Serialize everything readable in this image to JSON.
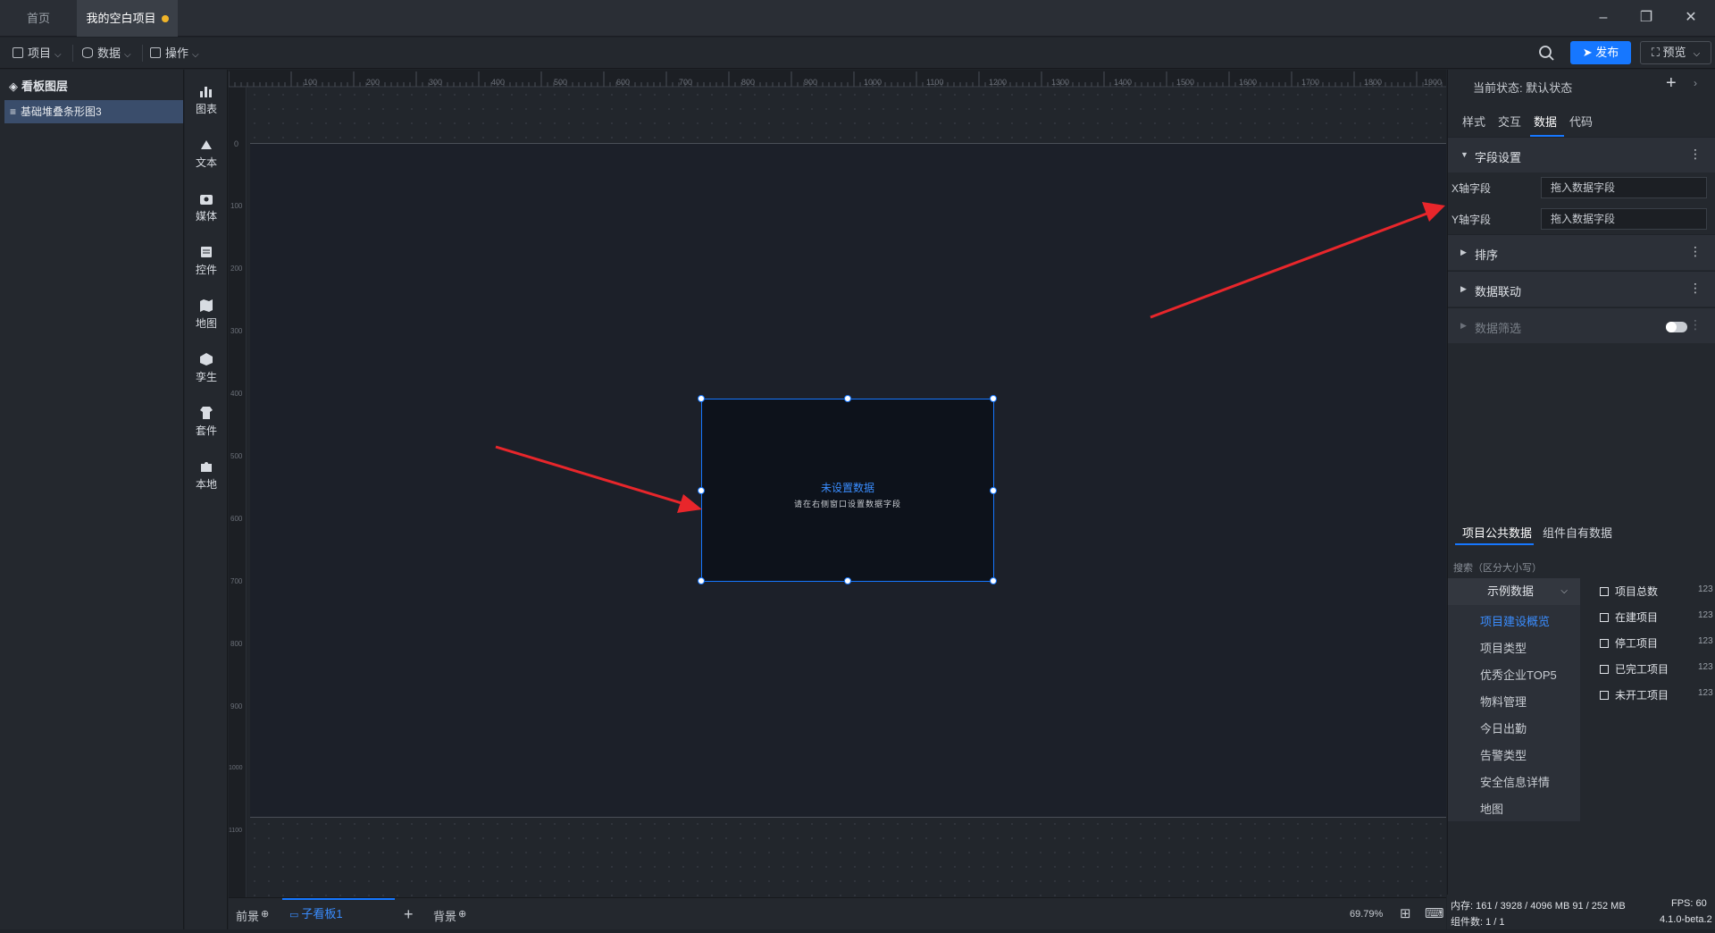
{
  "titlebar": {
    "tabs": [
      {
        "label": "首页"
      },
      {
        "label": "我的空白项目"
      }
    ]
  },
  "toolbar": {
    "menus": [
      {
        "label": "项目"
      },
      {
        "label": "数据"
      },
      {
        "label": "操作"
      }
    ],
    "publish_label": "发布",
    "preview_label": "预览",
    "accent": "#1677ff"
  },
  "layers": {
    "title": "看板图层",
    "items": [
      {
        "label": "基础堆叠条形图3"
      }
    ]
  },
  "components": [
    {
      "label": "图表",
      "icon": "bar-chart-icon"
    },
    {
      "label": "文本",
      "icon": "text-icon"
    },
    {
      "label": "媒体",
      "icon": "media-icon"
    },
    {
      "label": "控件",
      "icon": "widget-icon"
    },
    {
      "label": "地图",
      "icon": "map-icon"
    },
    {
      "label": "孪生",
      "icon": "twin-icon"
    },
    {
      "label": "套件",
      "icon": "kit-icon"
    },
    {
      "label": "本地",
      "icon": "puzzle-icon"
    }
  ],
  "rulers": {
    "h_labels": [
      "100",
      "200",
      "300",
      "400",
      "500",
      "600",
      "700",
      "800",
      "900",
      "1000",
      "1100",
      "1200",
      "1300",
      "1400",
      "1500",
      "1600",
      "1700",
      "1800",
      "1900"
    ],
    "v_labels": [
      "0",
      "100",
      "200",
      "300",
      "400",
      "500",
      "600",
      "700",
      "800",
      "900",
      "1000",
      "1100"
    ]
  },
  "widget": {
    "title": "未设置数据",
    "subtitle": "请在右侧窗口设置数据字段"
  },
  "bottombar": {
    "foreground": "前景",
    "sub_board": "子看板1",
    "background": "背景",
    "zoom": "69.79%"
  },
  "rightpanel": {
    "current_state_label": "当前状态:",
    "current_state_value": "默认状态",
    "tabs": [
      {
        "label": "样式"
      },
      {
        "label": "交互"
      },
      {
        "label": "数据"
      },
      {
        "label": "代码"
      }
    ],
    "sections": {
      "field_settings": "字段设置",
      "x_field_label": "X轴字段",
      "x_field_placeholder": "拖入数据字段",
      "y_field_label": "Y轴字段",
      "y_field_placeholder": "拖入数据字段",
      "sort": "排序",
      "linkage": "数据联动",
      "filter": "数据筛选"
    },
    "data_tabs": [
      {
        "label": "项目公共数据"
      },
      {
        "label": "组件自有数据"
      }
    ],
    "search_placeholder": "搜索（区分大小写）",
    "dataset_select": "示例数据",
    "datasets": [
      {
        "label": "项目建设概览",
        "active": true
      },
      {
        "label": "项目类型"
      },
      {
        "label": "优秀企业TOP5"
      },
      {
        "label": "物料管理"
      },
      {
        "label": "今日出勤"
      },
      {
        "label": "告警类型"
      },
      {
        "label": "安全信息详情"
      },
      {
        "label": "地图"
      }
    ],
    "fields": [
      {
        "label": "项目总数",
        "type": "123"
      },
      {
        "label": "在建项目",
        "type": "123"
      },
      {
        "label": "停工项目",
        "type": "123"
      },
      {
        "label": "已完工项目",
        "type": "123"
      },
      {
        "label": "未开工项目",
        "type": "123"
      }
    ]
  },
  "status": {
    "memory": "内存:  161 / 3928 / 4096 MB  91 / 252 MB",
    "fps": "FPS:  60",
    "components": "组件数: 1 / 1",
    "version": "4.1.0-beta.2"
  }
}
